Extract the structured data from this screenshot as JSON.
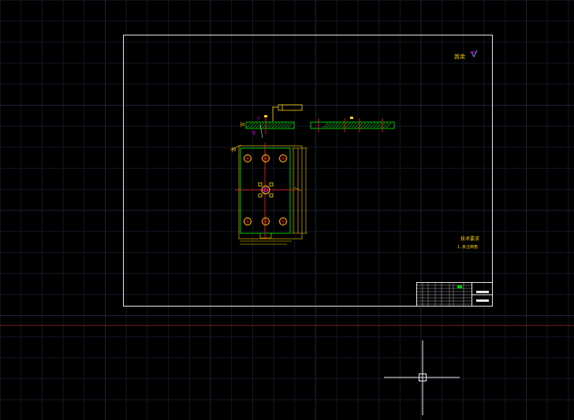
{
  "app": {
    "name": "CAD drawing viewport",
    "background": "#000000"
  },
  "colors": {
    "grid_minor": "#131825",
    "grid_major": "#1e2438",
    "frame": "#e6e6e6",
    "x_axis": "#7a2020",
    "hatch": "#00c800",
    "dimension": "#ffd200",
    "accent_magenta": "#ff00ff",
    "accent_red": "#ff2020",
    "accent_blue": "#4040ff",
    "crosshair": "#f0f0f0"
  },
  "drawing": {
    "sheet": "A4 landscape drawing frame",
    "views": [
      "top-section",
      "side-section",
      "plan-view"
    ],
    "notes": {
      "tech_req_1": "技术要求",
      "tech_req_2": "1.未注倒角",
      "roughness_corner": "其余"
    },
    "title_block": {
      "part_name": "",
      "drawing_no": ""
    }
  },
  "icons": {
    "crosshair": "crosshair-cursor-icon",
    "roughness": "surface-roughness-icon"
  }
}
